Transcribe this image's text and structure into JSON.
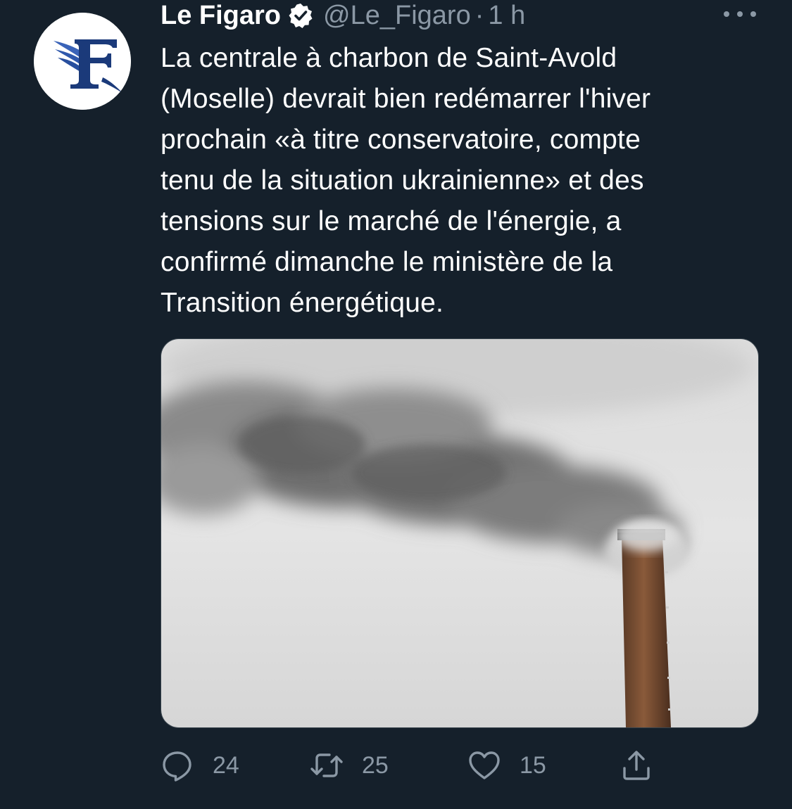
{
  "tweet": {
    "display_name": "Le Figaro",
    "handle": "@Le_Figaro",
    "separator": "·",
    "time": "1 h",
    "verified": true,
    "text": "La centrale à charbon de Saint-Avold\n(Moselle) devrait bien redémarrer l'hiver\nprochain «à titre conservatoire, compte\ntenu de la situation ukrainienne» et des\ntensions sur le marché de l'énergie, a\nconfirmé dimanche le ministère de la\nTransition énergétique.",
    "avatar_logo": "le-figaro-logo",
    "media": {
      "subject": "smoking-chimney-photo"
    },
    "actions": {
      "reply": {
        "icon": "reply-icon",
        "count": "24"
      },
      "retweet": {
        "icon": "retweet-icon",
        "count": "25"
      },
      "like": {
        "icon": "heart-icon",
        "count": "15"
      },
      "share": {
        "icon": "share-icon"
      }
    }
  },
  "colors": {
    "background": "#15202b",
    "text_primary": "#ffffff",
    "text_secondary": "#8b98a5",
    "logo_blue": "#1b3a7a"
  }
}
